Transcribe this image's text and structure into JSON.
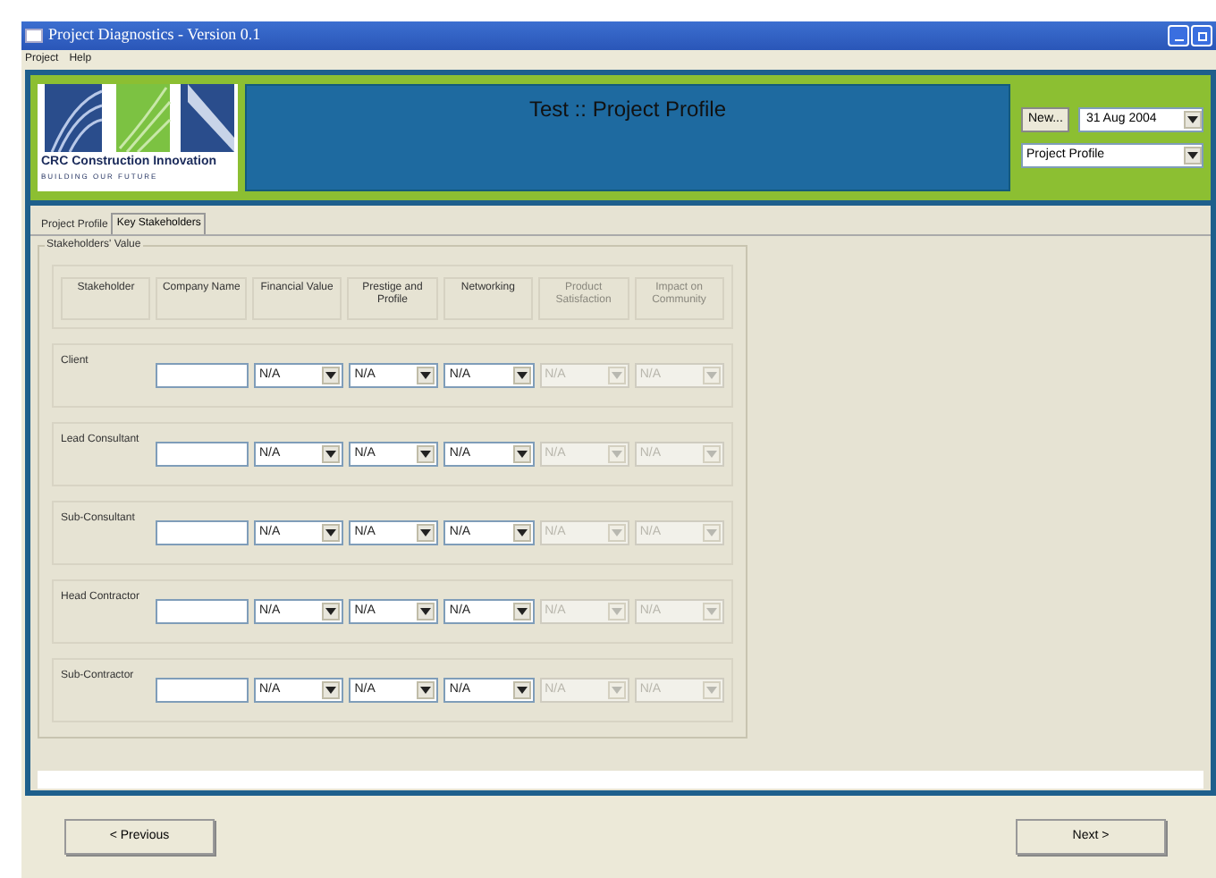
{
  "window": {
    "title": "Project Diagnostics - Version 0.1"
  },
  "menu": [
    "Project",
    "Help"
  ],
  "logo": {
    "name": "CRC Construction Innovation",
    "tagline": "BUILDING OUR FUTURE"
  },
  "header": {
    "title": "Test :: Project Profile",
    "new_button": "New...",
    "date": "31 Aug 2004",
    "profile": "Project Profile"
  },
  "tabs": [
    {
      "label": "Project Profile",
      "selected": false
    },
    {
      "label": "Key Stakeholders",
      "selected": true
    }
  ],
  "group": {
    "title": "Stakeholders' Value",
    "columns": [
      {
        "label": "Stakeholder",
        "disabled": false
      },
      {
        "label": "Company Name",
        "disabled": false
      },
      {
        "label": "Financial Value",
        "disabled": false
      },
      {
        "label": "Prestige and Profile",
        "disabled": false
      },
      {
        "label": "Networking",
        "disabled": false
      },
      {
        "label": "Product Satisfaction",
        "disabled": true
      },
      {
        "label": "Impact on Community",
        "disabled": true
      }
    ],
    "rows": [
      {
        "cells": [
          {
            "kind": "label",
            "value": "Client"
          },
          {
            "kind": "field"
          },
          {
            "value": "N/A",
            "disabled": false
          },
          {
            "value": "N/A",
            "disabled": false
          },
          {
            "value": "N/A",
            "disabled": false
          },
          {
            "value": "N/A",
            "disabled": true
          },
          {
            "value": "N/A",
            "disabled": true
          }
        ]
      },
      {
        "cells": [
          {
            "kind": "label",
            "value": "Lead Consultant"
          },
          {
            "kind": "field"
          },
          {
            "value": "N/A",
            "disabled": false
          },
          {
            "value": "N/A",
            "disabled": false
          },
          {
            "value": "N/A",
            "disabled": false
          },
          {
            "value": "N/A",
            "disabled": true
          },
          {
            "value": "N/A",
            "disabled": true
          }
        ]
      },
      {
        "cells": [
          {
            "kind": "label",
            "value": "Sub-Consultant"
          },
          {
            "kind": "field"
          },
          {
            "value": "N/A",
            "disabled": false
          },
          {
            "value": "N/A",
            "disabled": false
          },
          {
            "value": "N/A",
            "disabled": false
          },
          {
            "value": "N/A",
            "disabled": true
          },
          {
            "value": "N/A",
            "disabled": true
          }
        ]
      },
      {
        "cells": [
          {
            "kind": "label",
            "value": "Head Contractor"
          },
          {
            "kind": "field"
          },
          {
            "value": "N/A",
            "disabled": false
          },
          {
            "value": "N/A",
            "disabled": false
          },
          {
            "value": "N/A",
            "disabled": false
          },
          {
            "value": "N/A",
            "disabled": true
          },
          {
            "value": "N/A",
            "disabled": true
          }
        ]
      },
      {
        "cells": [
          {
            "kind": "label",
            "value": "Sub-Contractor"
          },
          {
            "kind": "field"
          },
          {
            "value": "N/A",
            "disabled": false
          },
          {
            "value": "N/A",
            "disabled": false
          },
          {
            "value": "N/A",
            "disabled": false
          },
          {
            "value": "N/A",
            "disabled": true
          },
          {
            "value": "N/A",
            "disabled": true
          }
        ]
      }
    ]
  },
  "buttons": {
    "previous": "< Previous",
    "next": "Next >"
  }
}
